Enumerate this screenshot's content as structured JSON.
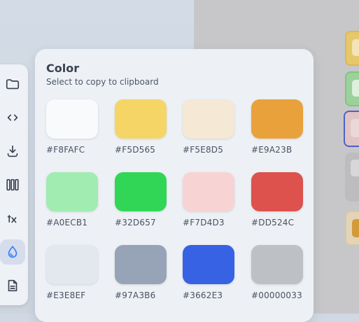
{
  "panel": {
    "title": "Color",
    "subtitle": "Select to copy to clipboard"
  },
  "colors": [
    {
      "label": "#F8FAFC",
      "hex": "#F8FAFC"
    },
    {
      "label": "#F5D565",
      "hex": "#F5D565"
    },
    {
      "label": "#F5E8D5",
      "hex": "#F5E8D5"
    },
    {
      "label": "#E9A23B",
      "hex": "#E9A23B"
    },
    {
      "label": "#A0ECB1",
      "hex": "#A0ECB1"
    },
    {
      "label": "#32D657",
      "hex": "#32D657"
    },
    {
      "label": "#F7D4D3",
      "hex": "#F7D4D3"
    },
    {
      "label": "#DD524C",
      "hex": "#DD524C"
    },
    {
      "label": "#E3E8EF",
      "hex": "#E3E8EF"
    },
    {
      "label": "#97A3B6",
      "hex": "#97A3B6"
    },
    {
      "label": "#3662E3",
      "hex": "#3662E3"
    },
    {
      "label": "#00000033",
      "hex": "#00000033"
    }
  ],
  "toolbar": {
    "tools": [
      {
        "icon": "folder-icon"
      },
      {
        "icon": "code-icon"
      },
      {
        "icon": "download-icon"
      },
      {
        "icon": "columns-icon"
      },
      {
        "icon": "clear-format-icon"
      },
      {
        "icon": "color-drop-icon",
        "active": true
      },
      {
        "icon": "document-icon"
      }
    ],
    "accent": "#3B82F6"
  }
}
